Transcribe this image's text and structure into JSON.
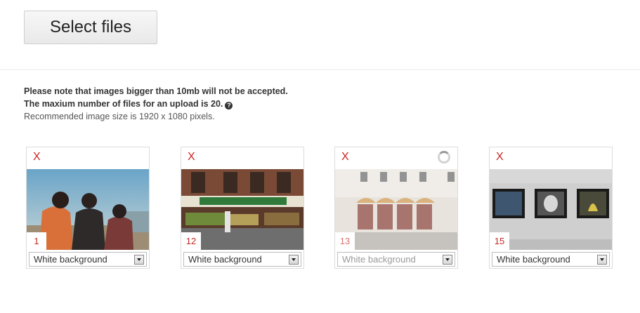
{
  "toolbar": {
    "select_files_label": "Select files"
  },
  "notes": {
    "line1": "Please note that images bigger than 10mb will not be accepted.",
    "line2": "The maxium number of files for an upload is 20.",
    "line3": "Recommended image size is 1920 x 1080 pixels."
  },
  "cards": [
    {
      "remove": "X",
      "number": "1",
      "background_option": "White background",
      "loading": false
    },
    {
      "remove": "X",
      "number": "12",
      "background_option": "White background",
      "loading": false
    },
    {
      "remove": "X",
      "number": "13",
      "background_option": "White background",
      "loading": true
    },
    {
      "remove": "X",
      "number": "15",
      "background_option": "White background",
      "loading": false
    }
  ],
  "colors": {
    "accent_red": "#c8261f"
  }
}
